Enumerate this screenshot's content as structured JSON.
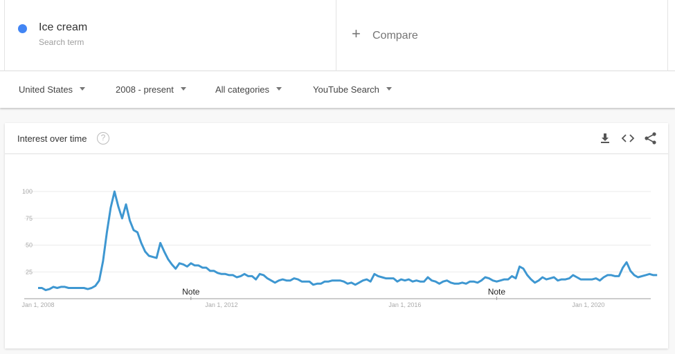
{
  "search_term": {
    "name": "Ice cream",
    "subtitle": "Search term",
    "color": "#4285f4"
  },
  "compare": {
    "label": "Compare",
    "icon": "plus-icon"
  },
  "filters": [
    {
      "label": "United States"
    },
    {
      "label": "2008 - present"
    },
    {
      "label": "All categories"
    },
    {
      "label": "YouTube Search"
    }
  ],
  "card": {
    "title": "Interest over time",
    "help_icon": "?",
    "actions": [
      "download-icon",
      "embed-icon",
      "share-icon"
    ]
  },
  "chart_data": {
    "type": "line",
    "title": "Interest over time",
    "xlabel": "",
    "ylabel": "",
    "ylim": [
      0,
      100
    ],
    "yticks": [
      25,
      50,
      75,
      100
    ],
    "xtick_labels": [
      "Jan 1, 2008",
      "Jan 1, 2012",
      "Jan 1, 2016",
      "Jan 1, 2020"
    ],
    "x_start": "2008-01",
    "x_interval": "monthly",
    "grid": true,
    "line_color": "#3e97d1",
    "annotations": [
      {
        "label": "Note",
        "date": "2011-05"
      },
      {
        "label": "Note",
        "date": "2018-01"
      }
    ],
    "series": [
      {
        "name": "Ice cream",
        "values": [
          10,
          10,
          8,
          9,
          11,
          10,
          11,
          11,
          10,
          10,
          10,
          10,
          10,
          9,
          10,
          12,
          17,
          35,
          62,
          85,
          100,
          86,
          75,
          88,
          73,
          64,
          62,
          52,
          44,
          40,
          39,
          38,
          52,
          44,
          37,
          32,
          28,
          33,
          32,
          30,
          33,
          31,
          31,
          29,
          29,
          26,
          26,
          24,
          23,
          23,
          22,
          22,
          20,
          21,
          23,
          21,
          21,
          18,
          23,
          22,
          19,
          17,
          15,
          17,
          18,
          17,
          17,
          19,
          18,
          16,
          16,
          16,
          13,
          14,
          14,
          16,
          16,
          17,
          17,
          17,
          16,
          14,
          15,
          13,
          15,
          17,
          18,
          16,
          23,
          21,
          20,
          19,
          19,
          19,
          16,
          18,
          17,
          18,
          16,
          17,
          16,
          16,
          20,
          17,
          16,
          14,
          16,
          17,
          15,
          14,
          14,
          15,
          14,
          16,
          16,
          15,
          17,
          20,
          19,
          17,
          16,
          17,
          18,
          18,
          21,
          19,
          30,
          28,
          22,
          18,
          15,
          17,
          20,
          18,
          19,
          20,
          17,
          18,
          18,
          19,
          22,
          20,
          18,
          18,
          18,
          18,
          19,
          17,
          20,
          22,
          22,
          21,
          21,
          29,
          34,
          26,
          22,
          20,
          21,
          22,
          23,
          22,
          22
        ]
      }
    ]
  }
}
